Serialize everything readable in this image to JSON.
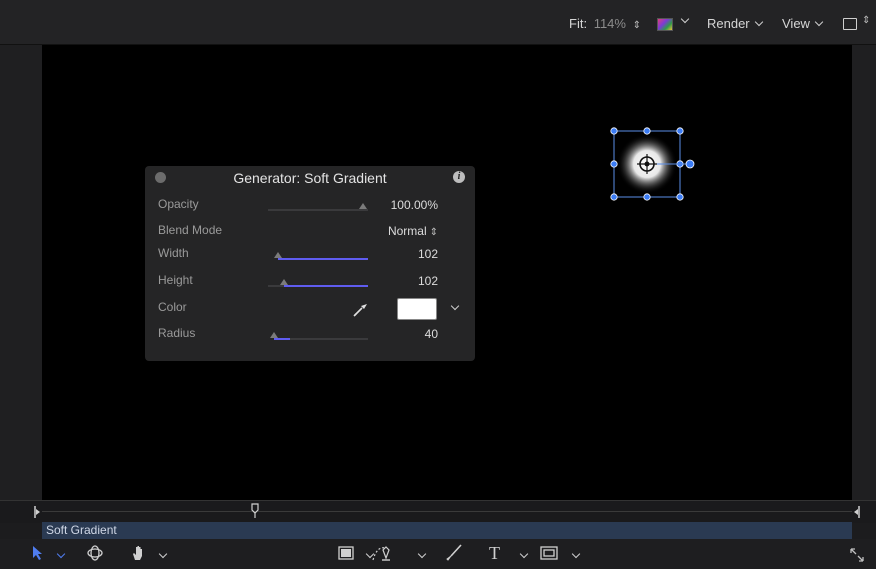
{
  "toolbar_top": {
    "fit_label": "Fit:",
    "fit_value": "114%",
    "render_label": "Render",
    "view_label": "View"
  },
  "hud": {
    "title": "Generator: Soft Gradient",
    "rows": {
      "opacity": {
        "label": "Opacity",
        "value": "100.00%",
        "level": 1.0
      },
      "blend_mode": {
        "label": "Blend Mode",
        "value": "Normal"
      },
      "width": {
        "label": "Width",
        "value": "102",
        "level": 1.0
      },
      "height": {
        "label": "Height",
        "value": "102",
        "level": 1.0
      },
      "color": {
        "label": "Color",
        "swatch": "#ffffff"
      },
      "radius": {
        "label": "Radius",
        "value": "40",
        "level": 0.12
      }
    }
  },
  "timeline": {
    "layer_name": "Soft Gradient"
  },
  "colors": {
    "accent": "#5f5cf0",
    "selection": "#3b7cf5",
    "canvas": "#000000"
  },
  "icons": {
    "select_tool": "arrow-icon",
    "orbit_tool": "orbit-icon",
    "pan_tool": "hand-icon",
    "shape_tool": "rectangle-icon",
    "bezier_tool": "pen-icon",
    "paint_tool": "brush-icon",
    "text_tool": "text-icon",
    "mask_tool": "mask-icon",
    "expand": "expand-icon"
  }
}
